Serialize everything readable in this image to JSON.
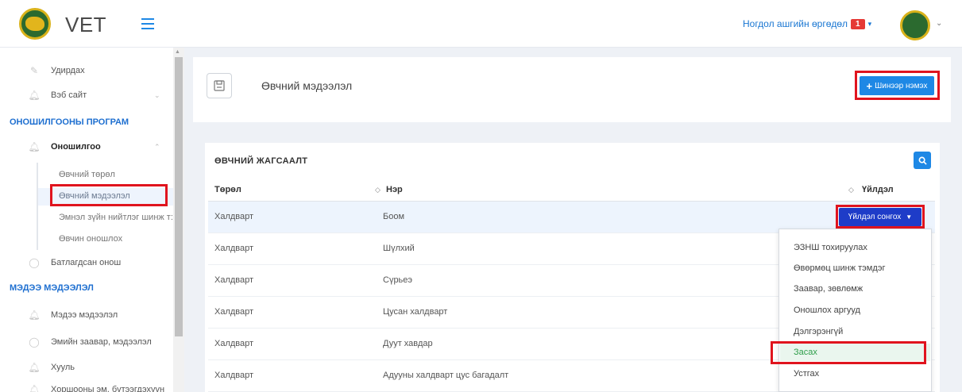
{
  "app": {
    "title": "VET",
    "logo_icon": "vet-logo-icon"
  },
  "topbar": {
    "notification_label": "Ногдол ашгийн өргөдөл",
    "notification_count": "1"
  },
  "sidebar": {
    "items_top": [
      {
        "label": "Удирдах",
        "icon": "pencil-icon"
      },
      {
        "label": "Вэб сайт",
        "icon": "bell-icon"
      }
    ],
    "section1": "ОНОШИЛГООНЫ ПРОГРАМ",
    "group": {
      "label": "Оношилгоо",
      "icon": "bell-icon"
    },
    "sub_items": [
      "Өвчний төрөл",
      "Өвчний мэдээлэл",
      "Эмнэл зүйн нийтлэг шинж т:",
      "Өвчин оношлох"
    ],
    "confirmed": "Батлагдсан онош",
    "section2": "МЭДЭЭ МЭДЭЭЛЭЛ",
    "items_bottom": [
      {
        "label": "Мэдээ мэдээлэл",
        "icon": "bell-icon"
      },
      {
        "label": "Эмийн заавар, мэдээлэл",
        "icon": "check-circle-icon"
      },
      {
        "label": "Хууль",
        "icon": "bell-icon"
      },
      {
        "label": "Хоршооны эм, бүтээгдэхүүн",
        "icon": "bell-icon"
      }
    ]
  },
  "header": {
    "title": "Өвчний мэдээлэл",
    "new_button": "Шинээр нэмэх"
  },
  "list": {
    "title": "ӨВЧНИЙ ЖАГСААЛТ",
    "columns": [
      "Төрөл",
      "Нэр",
      "Үйлдэл"
    ],
    "rows": [
      {
        "type": "Халдварт",
        "name": "Боом"
      },
      {
        "type": "Халдварт",
        "name": "Шүлхий"
      },
      {
        "type": "Халдварт",
        "name": "Сүрьеэ"
      },
      {
        "type": "Халдварт",
        "name": "Цусан халдварт"
      },
      {
        "type": "Халдварт",
        "name": "Дуут хавдар"
      },
      {
        "type": "Халдварт",
        "name": "Адууны халдварт цус багадалт"
      }
    ],
    "action_button": "Үйлдэл сонгох"
  },
  "dropdown": {
    "items": [
      "ЭЗНШ тохируулах",
      "Өвөрмөц шинж тэмдэг",
      "Заавар, зөвлөмж",
      "Оношлох аргууд",
      "Дэлгэрэнгүй",
      "Засах",
      "Устгах"
    ]
  },
  "colors": {
    "accent": "#1e88e5",
    "highlight": "#e0141e",
    "section": "#1e6fd0",
    "action": "#1e3cc8"
  }
}
